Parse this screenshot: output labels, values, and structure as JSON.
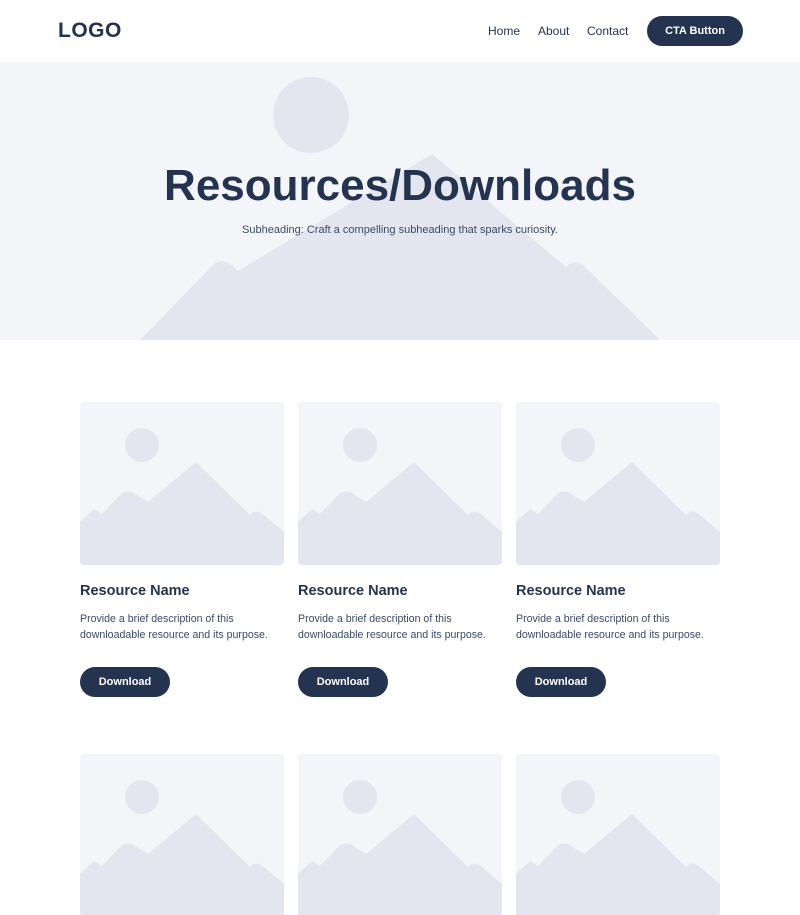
{
  "header": {
    "logo": "LOGO",
    "nav": [
      {
        "label": "Home"
      },
      {
        "label": "About"
      },
      {
        "label": "Contact"
      }
    ],
    "cta_label": "CTA Button"
  },
  "hero": {
    "title": "Resources/Downloads",
    "subtitle": "Subheading: Craft a compelling subheading that sparks curiosity."
  },
  "resources": [
    {
      "name": "Resource Name",
      "description": "Provide a brief description of this downloadable resource and its purpose.",
      "button": "Download"
    },
    {
      "name": "Resource Name",
      "description": "Provide a brief description of this downloadable resource and its purpose.",
      "button": "Download"
    },
    {
      "name": "Resource Name",
      "description": "Provide a brief description of this downloadable resource and its purpose.",
      "button": "Download"
    },
    {
      "name": "",
      "description": "",
      "button": ""
    },
    {
      "name": "",
      "description": "",
      "button": ""
    },
    {
      "name": "",
      "description": "",
      "button": ""
    }
  ],
  "icons": {
    "image_placeholder": "image-placeholder-icon"
  },
  "colors": {
    "primary": "#243350",
    "placeholder_bg": "#f4f5f8",
    "placeholder_shape": "#e3e6ee"
  }
}
